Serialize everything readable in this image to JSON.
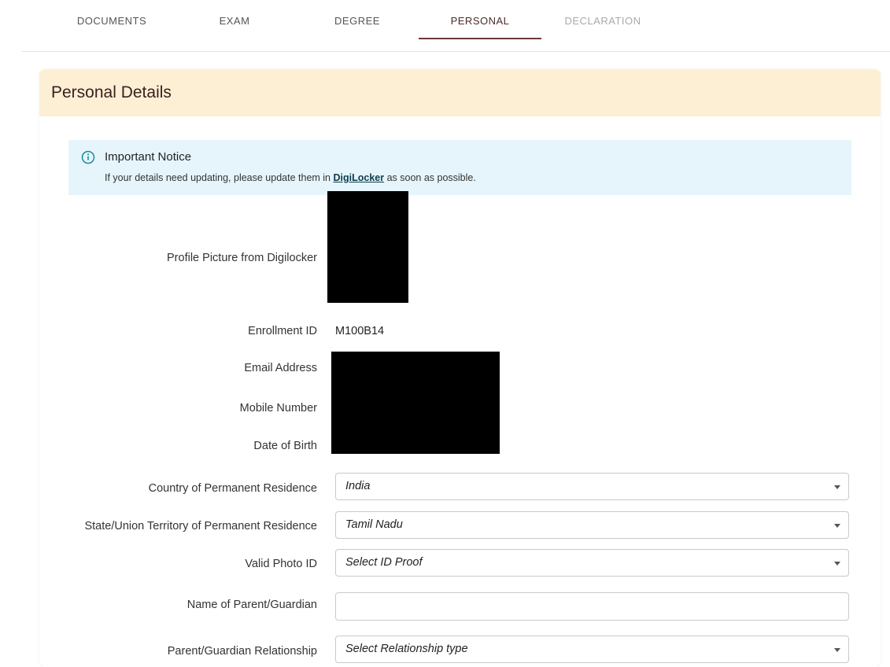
{
  "tabs": [
    {
      "label": "DOCUMENTS",
      "state": "normal"
    },
    {
      "label": "EXAM",
      "state": "normal"
    },
    {
      "label": "DEGREE",
      "state": "normal"
    },
    {
      "label": "PERSONAL",
      "state": "active"
    },
    {
      "label": "DECLARATION",
      "state": "disabled"
    }
  ],
  "section": {
    "title": "Personal Details"
  },
  "notice": {
    "icon": "info-icon",
    "title": "Important Notice",
    "text_before": "If your details need updating, please update them in ",
    "link": "DigiLocker",
    "text_after": " as soon as possible."
  },
  "profile": {
    "picture_label": "Profile Picture from Digilocker",
    "enrollment_label": "Enrollment ID",
    "enrollment_value": "M100B14",
    "email_label": "Email Address",
    "mobile_label": "Mobile Number",
    "dob_label": "Date of Birth"
  },
  "form": {
    "country_label": "Country of Permanent Residence",
    "country_value": "India",
    "state_label": "State/Union Territory of Permanent Residence",
    "state_value": "Tamil Nadu",
    "photo_id_label": "Valid Photo ID",
    "photo_id_value": "Select ID Proof",
    "parent_name_label": "Name of Parent/Guardian",
    "parent_name_value": "",
    "relationship_label": "Parent/Guardian Relationship",
    "relationship_value": "Select Relationship type"
  },
  "colors": {
    "header_bg": "#fdefd3",
    "notice_bg": "#e6f5fb",
    "active_tab_underline": "#6b3a3a"
  }
}
